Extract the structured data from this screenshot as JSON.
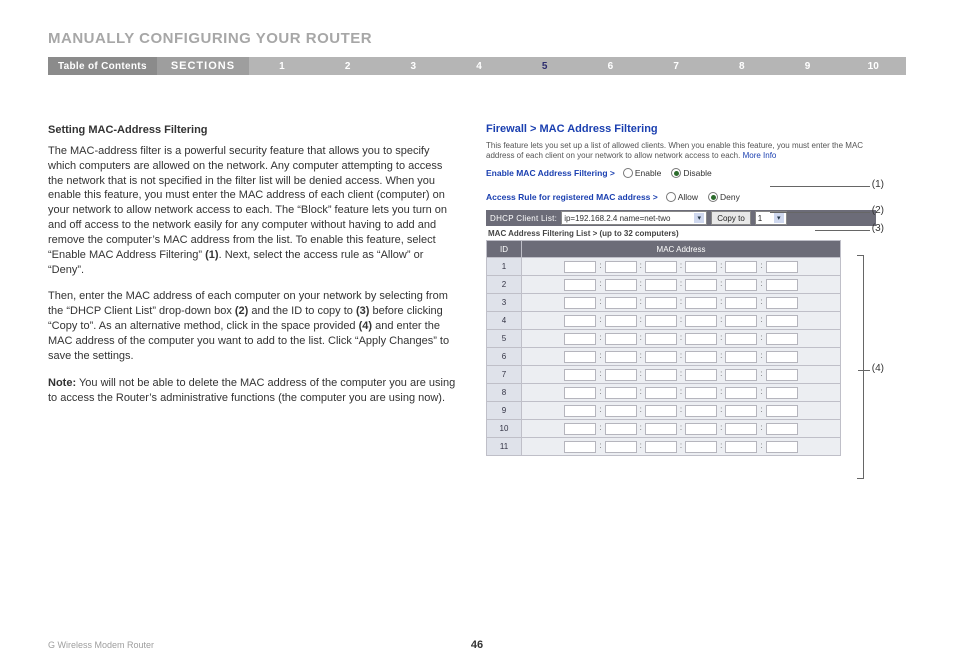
{
  "header": {
    "title": "MANUALLY CONFIGURING YOUR ROUTER",
    "nav": {
      "toc": "Table of Contents",
      "sections": "SECTIONS",
      "items": [
        "1",
        "2",
        "3",
        "4",
        "5",
        "6",
        "7",
        "8",
        "9",
        "10"
      ],
      "active_index": 4
    }
  },
  "left": {
    "heading": "Setting MAC-Address Filtering",
    "p1a": "The MAC-address filter is a powerful security feature that allows you to specify which computers are allowed on the network. Any computer attempting to access the network that is not specified in the filter list will be denied access. When you enable this feature, you must enter the MAC address of each client (computer) on your network to allow network access to each. The “Block” feature lets you turn on and off access to the network easily for any computer without having to add and remove the computer’s MAC address from the list. To enable this feature, select “Enable MAC Address Filtering” ",
    "p1b": "(1)",
    "p1c": ". Next, select the access rule as “Allow” or “Deny”.",
    "p2a": "Then, enter the MAC address of each computer on your network by selecting from the “DHCP Client List” drop-down box ",
    "p2b": "(2)",
    "p2c": " and the ID to copy to ",
    "p2d": "(3)",
    "p2e": " before clicking “Copy to”. As an alternative method, click in the space provided ",
    "p2f": "(4)",
    "p2g": " and enter the MAC address of the computer you want to add to the list. Click “Apply Changes” to save the settings.",
    "note_label": "Note:",
    "note_body": " You will not be able to delete the MAC address of the computer you are using to access the Router’s administrative functions (the computer you are using now)."
  },
  "right": {
    "breadcrumb": "Firewall > MAC Address Filtering",
    "desc_a": "This feature lets you set up a list of allowed clients. When you enable this feature, you must enter the MAC address of each client on your network to allow network access to each. ",
    "desc_more": "More Info",
    "enable_label": "Enable MAC Address Filtering >",
    "enable_opts": {
      "a": "Enable",
      "b": "Disable",
      "selected": "b"
    },
    "rule_label": "Access Rule for registered MAC address >",
    "rule_opts": {
      "a": "Allow",
      "b": "Deny",
      "selected": "b"
    },
    "dhcp": {
      "label": "DHCP Client List:",
      "value": "ip=192.168.2.4 name=net-two",
      "copy_btn": "Copy to",
      "copy_id": "1"
    },
    "list_header": "MAC Address Filtering List > (up to 32 computers)",
    "table": {
      "col_id": "ID",
      "col_mac": "MAC Address",
      "rows": [
        "1",
        "2",
        "3",
        "4",
        "5",
        "6",
        "7",
        "8",
        "9",
        "10",
        "11"
      ]
    },
    "callouts": {
      "c1": "(1)",
      "c2": "(2)",
      "c3": "(3)",
      "c4": "(4)"
    }
  },
  "footer": {
    "product": "G Wireless Modem Router",
    "page": "46"
  }
}
